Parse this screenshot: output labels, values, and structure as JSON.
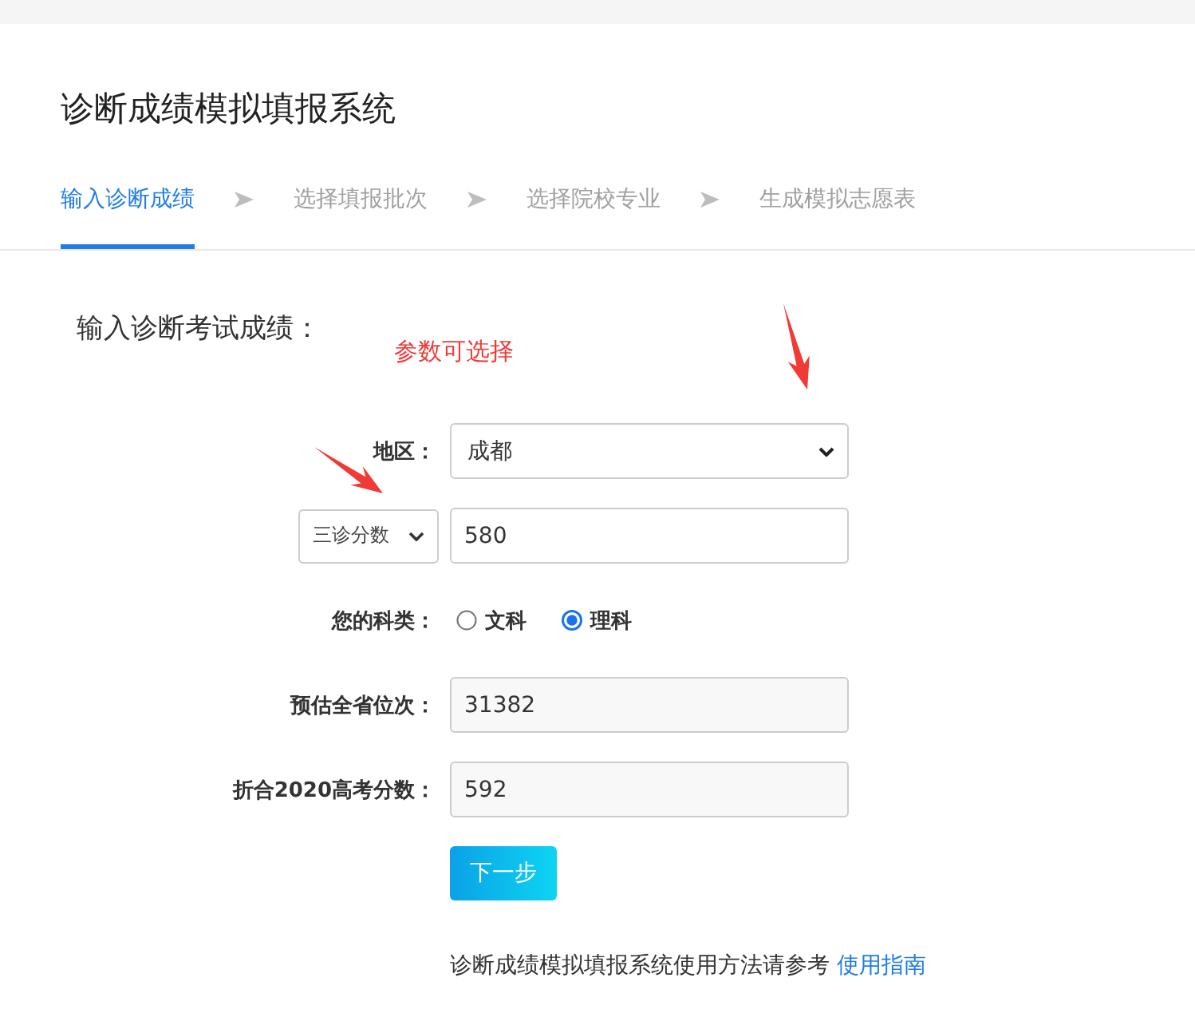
{
  "page_title": "诊断成绩模拟填报系统",
  "steps": [
    {
      "label": "输入诊断成绩",
      "selected": true
    },
    {
      "label": "选择填报批次",
      "selected": false
    },
    {
      "label": "选择院校专业",
      "selected": false
    },
    {
      "label": "生成模拟志愿表",
      "selected": false
    }
  ],
  "section_heading": "输入诊断考试成绩：",
  "annotation": "参数可选择",
  "form_rows": [
    {
      "kind": "select",
      "label": "地区：",
      "value": "成都"
    },
    {
      "kind": "score",
      "picker": "三诊分数",
      "value": "580"
    },
    {
      "kind": "radio",
      "label": "您的科类：",
      "options": [
        {
          "label": "文科",
          "selected": false
        },
        {
          "label": "理科",
          "selected": true
        }
      ]
    },
    {
      "kind": "readonly",
      "label": "预估全省位次：",
      "value": "31382"
    },
    {
      "kind": "readonly",
      "label": "折合2020高考分数：",
      "value": "592"
    }
  ],
  "next_button": "下一步",
  "footer": {
    "text": "诊断成绩模拟填报系统使用方法请参考",
    "link": "使用指南"
  }
}
